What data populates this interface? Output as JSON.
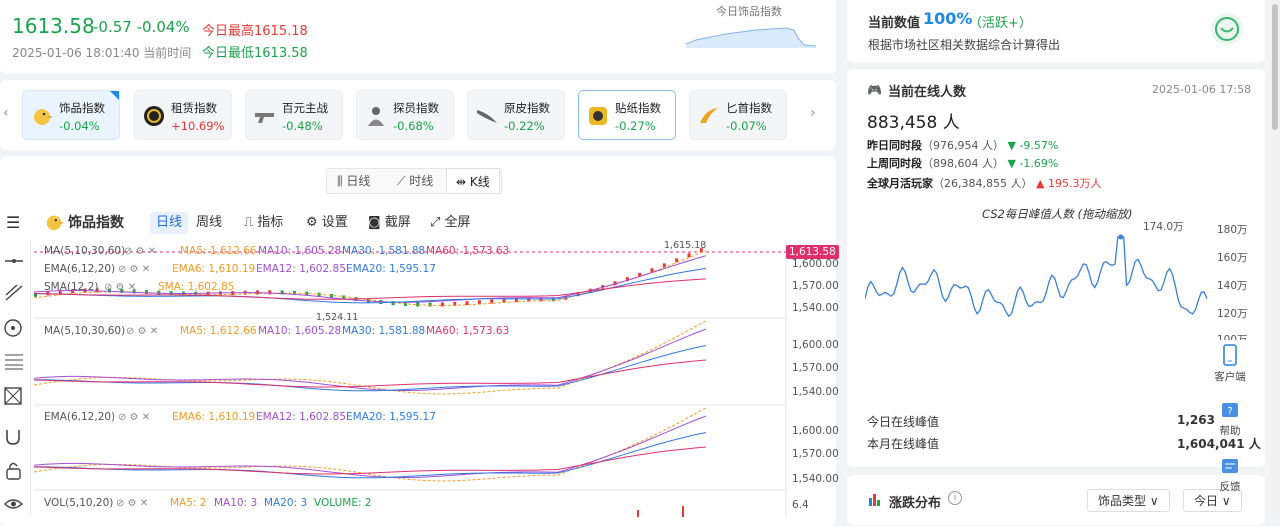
{
  "header": {
    "price": "1613.58",
    "change": "-0.57",
    "change_pct": "-0.04%",
    "high_label": "今日最高",
    "high_value": "1615.18",
    "low_label": "今日最低",
    "low_value": "1613.58",
    "datetime": "2025-01-06 18:01:40",
    "time_label": "当前时间",
    "spark_title": "今日饰品指数"
  },
  "categories": [
    {
      "name": "饰品指数",
      "value": "-0.04%",
      "dir": "down"
    },
    {
      "name": "租赁指数",
      "value": "+10.69%",
      "dir": "up"
    },
    {
      "name": "百元主战",
      "value": "-0.48%",
      "dir": "down"
    },
    {
      "name": "探员指数",
      "value": "-0.68%",
      "dir": "down"
    },
    {
      "name": "原皮指数",
      "value": "-0.22%",
      "dir": "down"
    },
    {
      "name": "贴纸指数",
      "value": "-0.27%",
      "dir": "down"
    },
    {
      "name": "匕首指数",
      "value": "-0.07%",
      "dir": "down"
    }
  ],
  "chart_tabs": [
    "日线",
    "时线",
    "K线"
  ],
  "chart_toolbar": {
    "title": "饰品指数",
    "period_day": "日线",
    "period_week": "周线",
    "indicator": "指标",
    "settings": "设置",
    "screenshot": "截屏",
    "fullscreen": "全屏"
  },
  "chart_data": [
    {
      "type": "line",
      "title": "MA(5,10,30,60)",
      "series": [
        {
          "name": "MA5",
          "values": [
            1612.66
          ]
        },
        {
          "name": "MA10",
          "values": [
            1605.28
          ]
        },
        {
          "name": "MA30",
          "values": [
            1581.88
          ]
        },
        {
          "name": "MA60",
          "values": [
            1573.63
          ]
        }
      ],
      "ylim": [
        1535,
        1625
      ],
      "ticks": [
        "1,600.00",
        "1,570.00",
        "1,540.00"
      ],
      "price_tag": "1,613.58",
      "max_label": "1,615.18",
      "min_label": "1,524.11"
    }
  ],
  "overlay": {
    "ma_title": "MA(5,10,30,60)",
    "ema_title": "EMA(6,12,20)",
    "sma_title": "SMA(12,2)",
    "vol_title": "VOL(5,10,20)",
    "ma5": "MA5: 1,612.66",
    "ma10": "MA10: 1,605.28",
    "ma30": "MA30: 1,581.88",
    "ma60": "MA60: 1,573.63",
    "ema6": "EMA6: 1,610.19",
    "ema12": "EMA12: 1,602.85",
    "ema20": "EMA20: 1,595.17",
    "sma": "SMA: 1,602.85",
    "vma5": "MA5: 2",
    "vma10": "MA10: 3",
    "vma20": "MA20: 3",
    "volume": "VOLUME: 2",
    "vol_tick": "6.4",
    "tick_1600": "1,600.00",
    "tick_1570": "1,570.00",
    "tick_1540": "1,540.00"
  },
  "right_top": {
    "label": "当前数值",
    "value": "100%",
    "status": "（活跃+）",
    "desc": "根据市场社区相关数据综合计算得出"
  },
  "online": {
    "title": "当前在线人数",
    "datetime": "2025-01-06 17:58",
    "count": "883,458 人",
    "yesterday_label": "昨日同时段",
    "yesterday_value": "（976,954 人）",
    "yesterday_change": "-9.57%",
    "lastweek_label": "上周同时段",
    "lastweek_value": "（898,604 人）",
    "lastweek_change": "-1.69%",
    "monthly_label": "全球月活玩家",
    "monthly_value": "（26,384,855 人）",
    "monthly_change": "195.3万人",
    "chart_title": "CS2每日峰值人数 (拖动缩放)",
    "peak_label": "174.0万",
    "y_ticks": [
      "180万",
      "160万",
      "140万",
      "120万",
      "100万"
    ],
    "today_peak_label": "今日在线峰值",
    "today_peak_value": "1,263",
    "month_peak_label": "本月在线峰值",
    "month_peak_value": "1,604,041 人"
  },
  "side_actions": {
    "client": "客户端",
    "help": "帮助",
    "feedback": "反馈"
  },
  "distribution": {
    "title": "涨跌分布",
    "type_select": "饰品类型",
    "day_select": "今日"
  },
  "colors": {
    "up": "#e53935",
    "down": "#1aa34a",
    "ma5": "#f59a23",
    "ma10": "#a24fd6",
    "ma30": "#2f7ae5",
    "ma60": "#e0306b",
    "accent": "#1e88e5"
  }
}
